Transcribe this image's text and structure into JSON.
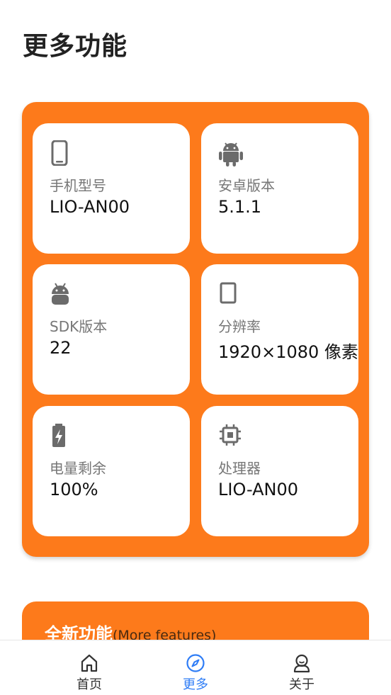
{
  "page_title": "更多功能",
  "info_cards": [
    {
      "icon": "phone-icon",
      "label": "手机型号",
      "value": "LIO-AN00"
    },
    {
      "icon": "android-icon",
      "label": "安卓版本",
      "value": "5.1.1"
    },
    {
      "icon": "android-head-icon",
      "label": "SDK版本",
      "value": "22"
    },
    {
      "icon": "screen-icon",
      "label": "分辨率",
      "value": "1920×1080 像素"
    },
    {
      "icon": "battery-icon",
      "label": "电量剩余",
      "value": "100%"
    },
    {
      "icon": "cpu-icon",
      "label": "处理器",
      "value": "LIO-AN00"
    }
  ],
  "feature_section": {
    "title": "全新功能",
    "subtitle": "(More features)"
  },
  "bottom_nav": {
    "items": [
      {
        "label": "首页",
        "icon": "home-icon",
        "active": false
      },
      {
        "label": "更多",
        "icon": "compass-icon",
        "active": true
      },
      {
        "label": "关于",
        "icon": "user-icon",
        "active": false
      }
    ]
  },
  "colors": {
    "accent": "#fd7a1b",
    "nav_active": "#2f7df6",
    "icon_gray": "#6b6b6b"
  }
}
